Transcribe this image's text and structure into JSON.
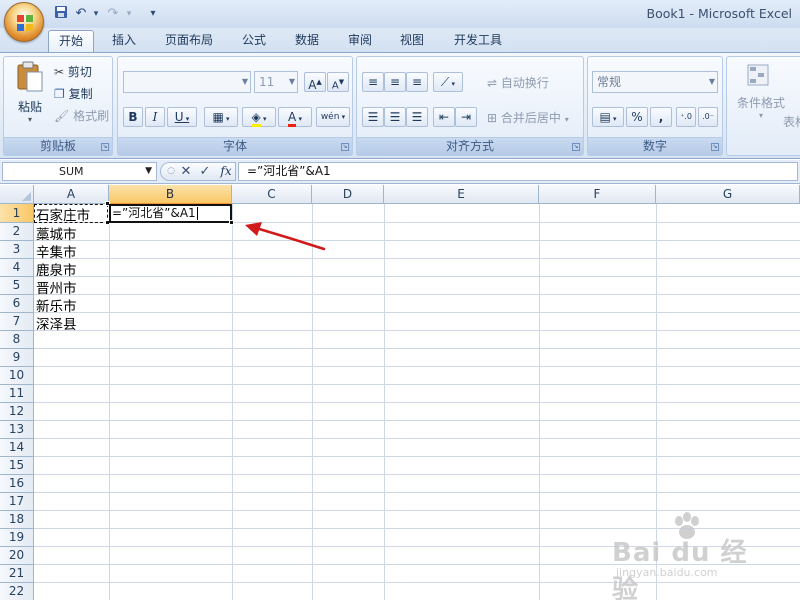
{
  "window": {
    "title": "Book1 - Microsoft Excel",
    "quick_access": {
      "undo": "↶",
      "redo": "↷",
      "customize": "▾"
    }
  },
  "tabs": [
    {
      "label": "开始",
      "active": true
    },
    {
      "label": "插入"
    },
    {
      "label": "页面布局"
    },
    {
      "label": "公式"
    },
    {
      "label": "数据"
    },
    {
      "label": "审阅"
    },
    {
      "label": "视图"
    },
    {
      "label": "开发工具"
    }
  ],
  "ribbon": {
    "clipboard": {
      "label": "剪贴板",
      "paste": "粘贴",
      "cut": "剪切",
      "copy": "复制",
      "format_painter": "格式刷"
    },
    "font": {
      "label": "字体",
      "font_name": "",
      "font_size": "11",
      "bold": "B",
      "italic": "I",
      "underline": "U",
      "grow": "A",
      "shrink": "A",
      "phonetic": "wén"
    },
    "alignment": {
      "label": "对齐方式",
      "wrap_text": "自动换行",
      "merge_center": "合并后居中"
    },
    "number": {
      "label": "数字",
      "format": "常规",
      "percent": "%",
      "comma": ","
    },
    "styles": {
      "conditional_format": "条件格式",
      "table_format_partial": "表格"
    }
  },
  "formula_bar": {
    "name_box": "SUM",
    "cancel": "✕",
    "enter": "✓",
    "fx": "fx",
    "formula": "=”河北省”&A1"
  },
  "columns": [
    "A",
    "B",
    "C",
    "D",
    "E",
    "F",
    "G"
  ],
  "rows": [
    "1",
    "2",
    "3",
    "4",
    "5",
    "6",
    "7",
    "8",
    "9",
    "10",
    "11",
    "12",
    "13",
    "14",
    "15",
    "16",
    "17",
    "18",
    "19",
    "20",
    "21",
    "22"
  ],
  "cells": {
    "A": [
      "石家庄市",
      "藁城市",
      "辛集市",
      "鹿泉市",
      "晋州市",
      "新乐市",
      "深泽县"
    ]
  },
  "active_cell": {
    "ref": "B1",
    "content": "=”河北省”&A1"
  },
  "colors": {
    "accent": "#f9c866",
    "arrow": "#d11a1a",
    "ribbon": "#dbe7f5"
  },
  "watermark": {
    "text": "Bai du 经验",
    "url": "jingyan.baidu.com"
  }
}
